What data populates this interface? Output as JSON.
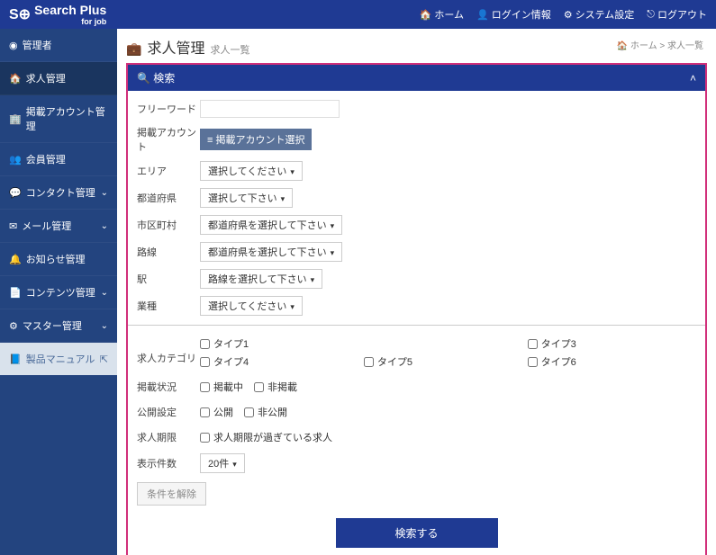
{
  "header": {
    "logo_main": "Search Plus",
    "logo_sub": "for job",
    "nav": {
      "home": "ホーム",
      "login_info": "ログイン情報",
      "system": "システム設定",
      "logout": "ログアウト"
    }
  },
  "sidebar": {
    "items": [
      {
        "label": "管理者",
        "icon": "user"
      },
      {
        "label": "求人管理",
        "icon": "home"
      },
      {
        "label": "掲載アカウント管理",
        "icon": "building"
      },
      {
        "label": "会員管理",
        "icon": "users"
      },
      {
        "label": "コンタクト管理",
        "icon": "comment",
        "caret": true
      },
      {
        "label": "メール管理",
        "icon": "envelope",
        "caret": true
      },
      {
        "label": "お知らせ管理",
        "icon": "bell"
      },
      {
        "label": "コンテンツ管理",
        "icon": "file",
        "caret": true
      },
      {
        "label": "マスター管理",
        "icon": "cog",
        "caret": true
      }
    ],
    "manual": "製品マニュアル"
  },
  "page": {
    "title": "求人管理",
    "subtitle": "求人一覧",
    "breadcrumb_home": "ホーム",
    "breadcrumb_current": "求人一覧"
  },
  "search": {
    "header": "検索",
    "freeword_label": "フリーワード",
    "freeword_value": "",
    "account_label": "掲載アカウント",
    "account_button": "掲載アカウント選択",
    "area_label": "エリア",
    "area_select": "選択してください",
    "pref_label": "都道府県",
    "pref_select": "選択して下さい",
    "city_label": "市区町村",
    "city_select": "都道府県を選択して下さい",
    "line_label": "路線",
    "line_select": "都道府県を選択して下さい",
    "station_label": "駅",
    "station_select": "路線を選択して下さい",
    "industry_label": "業種",
    "industry_select": "選択してください",
    "category_label": "求人カテゴリ",
    "types": {
      "t1": "タイプ1",
      "t3": "タイプ3",
      "t4": "タイプ4",
      "t5": "タイプ5",
      "t6": "タイプ6"
    },
    "post_status_label": "掲載状況",
    "post_status": {
      "on": "掲載中",
      "off": "非掲載"
    },
    "publish_label": "公開設定",
    "publish": {
      "on": "公開",
      "off": "非公開"
    },
    "expire_label": "求人期限",
    "expire_check": "求人期限が過ぎている求人",
    "per_page_label": "表示件数",
    "per_page_value": "20件",
    "clear_button": "条件を解除",
    "submit_button": "検索する"
  }
}
